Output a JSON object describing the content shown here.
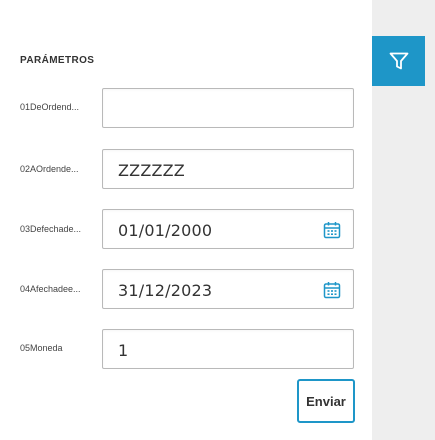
{
  "section": {
    "title": "PARÁMETROS"
  },
  "params": [
    {
      "label": "01DeOrdend...",
      "value": ""
    },
    {
      "label": "02AOrdende...",
      "value": "ZZZZZZ"
    },
    {
      "label": "03Defechade...",
      "value": "01/01/2000",
      "icon": "calendar-icon"
    },
    {
      "label": "04Afechadee...",
      "value": "31/12/2023",
      "icon": "calendar-icon"
    },
    {
      "label": "05Moneda",
      "value": "1"
    }
  ],
  "actions": {
    "send_label": "Enviar"
  },
  "toolbar": {
    "filter_icon": "filter-icon"
  },
  "colors": {
    "accent": "#1e96c8",
    "strip_background": "#eeeeee",
    "field_border": "#b9b9b9"
  }
}
